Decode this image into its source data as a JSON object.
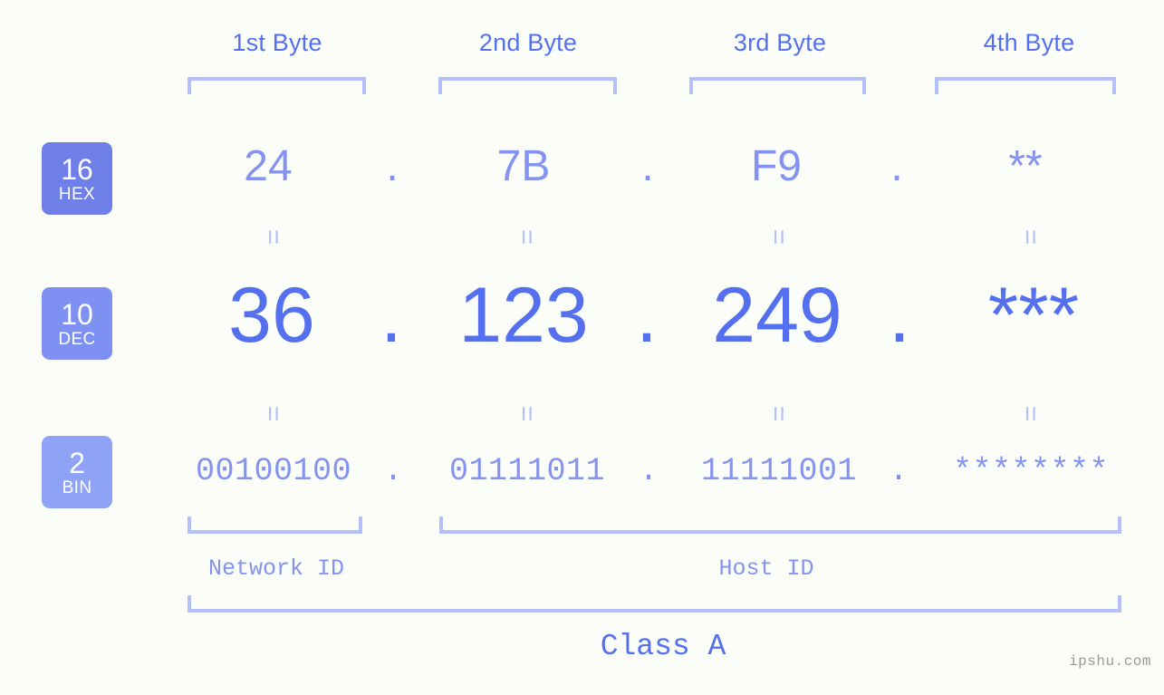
{
  "colors": {
    "background": "#fafdf8",
    "accent_strong": "#5570ee",
    "accent_light": "#8593f0",
    "bracket": "#b3c0f9",
    "badge_hex": "#6f7fe8",
    "badge_dec": "#7e90f2",
    "badge_bin": "#8ea3f5",
    "watermark": "#9a9a9a"
  },
  "headers": [
    {
      "label": "1st Byte"
    },
    {
      "label": "2nd Byte"
    },
    {
      "label": "3rd Byte"
    },
    {
      "label": "4th Byte"
    }
  ],
  "badges": [
    {
      "num": "16",
      "unit": "HEX"
    },
    {
      "num": "10",
      "unit": "DEC"
    },
    {
      "num": "2",
      "unit": "BIN"
    }
  ],
  "rows": {
    "hex": {
      "values": [
        "24",
        "7B",
        "F9",
        "**"
      ],
      "separator": "."
    },
    "dec": {
      "values": [
        "36",
        "123",
        "249",
        "***"
      ],
      "separator": "."
    },
    "bin": {
      "values": [
        "00100100",
        "01111011",
        "11111001",
        "********"
      ],
      "separator": "."
    }
  },
  "separators": {
    "equals": "=",
    "count": 8
  },
  "segments": {
    "network_id": "Network ID",
    "host_id": "Host ID",
    "class": "Class A"
  },
  "watermark": "ipshu.com"
}
